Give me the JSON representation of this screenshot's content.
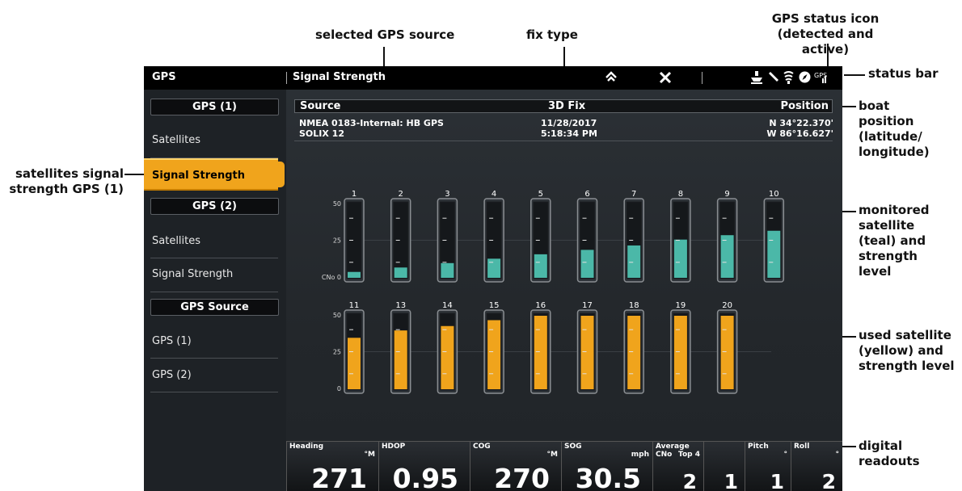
{
  "annotations": {
    "selected_gps_source": "selected GPS source",
    "fix_type": "fix type",
    "gps_status_icon_line1": "GPS status icon",
    "gps_status_icon_line2": "(detected and active)",
    "status_bar": "status bar",
    "boat_position_1": "boat",
    "boat_position_2": "position",
    "boat_position_3": "(latitude/",
    "boat_position_4": "longitude)",
    "satellites_signal_1": "satellites signal",
    "satellites_signal_2": "strength GPS (1)",
    "monitored_1": "monitored",
    "monitored_2": "satellite",
    "monitored_3": "(teal) and",
    "monitored_4": "strength",
    "monitored_5": "level",
    "used_1": "used satellite",
    "used_2": "(yellow) and",
    "used_3": "strength level",
    "digital_1": "digital",
    "digital_2": "readouts"
  },
  "status_bar": {
    "app_title": "GPS",
    "page_title": "Signal Strength",
    "icons": [
      "home-icon",
      "close-icon",
      "boat-icon",
      "pen-icon",
      "sonar-icon",
      "compass-icon",
      "gps-status-icon"
    ]
  },
  "sidebar": {
    "group1": "GPS (1)",
    "item1_satellites": "Satellites",
    "item1_signal": "Signal Strength",
    "group2": "GPS (2)",
    "item2_satellites": "Satellites",
    "item2_signal": "Signal Strength",
    "group3": "GPS Source",
    "item3_gps1": "GPS (1)",
    "item3_gps2": "GPS (2)"
  },
  "info": {
    "source_header": "Source",
    "fix_header": "3D Fix",
    "position_header": "Position",
    "source_line1": "NMEA 0183-Internal: HB GPS",
    "source_line2": "SOLIX 12",
    "date": "11/28/2017",
    "time": "5:18:34 PM",
    "latitude": "N 34°22.370'",
    "longitude": "W 86°16.627'"
  },
  "chart_data": [
    {
      "type": "bar",
      "label": "monitored",
      "color": "#4bb8a8",
      "categories": [
        "1",
        "2",
        "3",
        "4",
        "5",
        "6",
        "7",
        "8",
        "9",
        "10"
      ],
      "values": [
        4,
        7,
        10,
        13,
        16,
        19,
        22,
        26,
        29,
        32
      ],
      "ylim": [
        0,
        50
      ],
      "yticks": [
        "50",
        "25",
        "CNo  0"
      ]
    },
    {
      "type": "bar",
      "label": "used",
      "color": "#f0a41c",
      "categories": [
        "11",
        "13",
        "14",
        "15",
        "16",
        "17",
        "18",
        "19",
        "20"
      ],
      "values": [
        35,
        40,
        43,
        47,
        50,
        50,
        50,
        50,
        50
      ],
      "ylim": [
        0,
        50
      ],
      "yticks": [
        "50",
        "25",
        "0"
      ]
    }
  ],
  "readouts": [
    {
      "label": "Heading",
      "unit": "°M",
      "value": "271"
    },
    {
      "label": "HDOP",
      "unit": "",
      "value": "0.95"
    },
    {
      "label": "COG",
      "unit": "°M",
      "value": "270"
    },
    {
      "label": "SOG",
      "unit": "mph",
      "value": "30.5"
    },
    {
      "label": "Average CNo",
      "unit": "Top 4",
      "value": "2"
    },
    {
      "label": "",
      "unit": "",
      "value": "1"
    },
    {
      "label": "Pitch",
      "unit": "°",
      "value": "1"
    },
    {
      "label": "Roll",
      "unit": "°",
      "value": "2"
    }
  ]
}
